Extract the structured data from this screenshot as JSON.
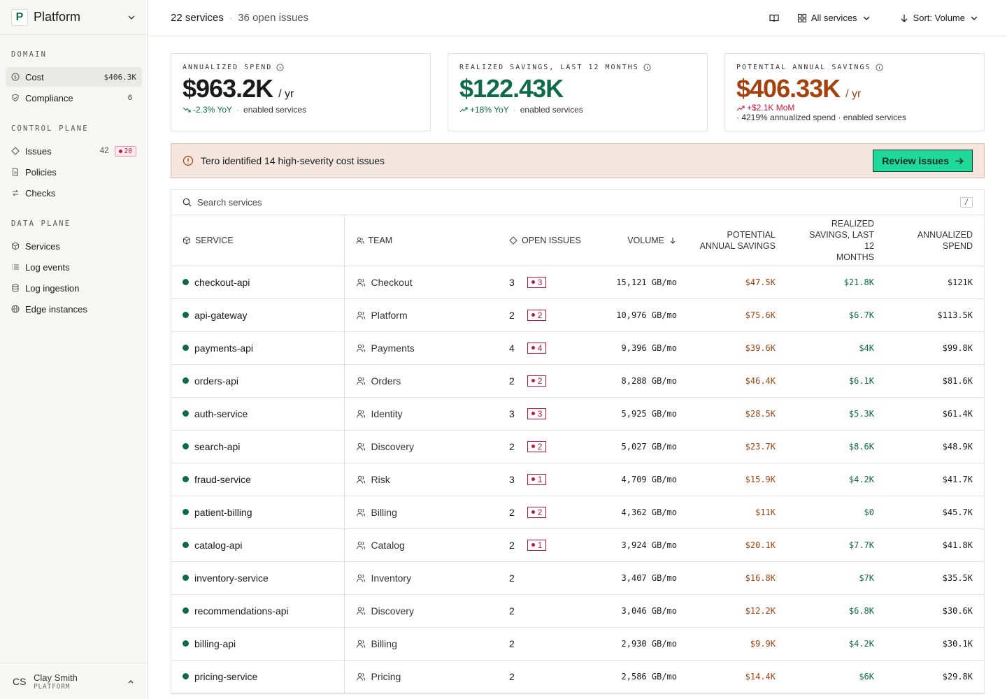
{
  "sidebar": {
    "workspace": {
      "letter": "P",
      "name": "Platform"
    },
    "sections": {
      "domain": "DOMAIN",
      "control": "CONTROL PLANE",
      "data": "DATA PLANE"
    },
    "items": {
      "cost": {
        "label": "Cost",
        "badge": "$406.3K"
      },
      "compliance": {
        "label": "Compliance",
        "badge": "6"
      },
      "issues": {
        "label": "Issues",
        "count": "42",
        "flag": "20"
      },
      "policies": {
        "label": "Policies"
      },
      "checks": {
        "label": "Checks"
      },
      "services": {
        "label": "Services"
      },
      "log_events": {
        "label": "Log events"
      },
      "log_ingestion": {
        "label": "Log ingestion"
      },
      "edge_instances": {
        "label": "Edge instances"
      }
    },
    "user": {
      "initials": "CS",
      "name": "Clay Smith",
      "org": "PLATFORM"
    }
  },
  "topbar": {
    "title": "22 services",
    "sep": "·",
    "subtitle": "36 open issues",
    "filter_label": "All services",
    "sort_label": "Sort: Volume"
  },
  "cards": {
    "spend": {
      "label": "ANNUALIZED SPEND",
      "value": "$963.2K",
      "unit": "/ yr",
      "trend": "-2.3% YoY",
      "sep": "·",
      "note": "enabled services"
    },
    "realized": {
      "label": "REALIZED SAVINGS, LAST 12 MONTHS",
      "value": "$122.43K",
      "trend": "+18% YoY",
      "sep": "·",
      "note": "enabled services"
    },
    "potential": {
      "label": "POTENTIAL ANNUAL SAVINGS",
      "value": "$406.33K",
      "unit": "/ yr",
      "trend": "+$2.1K MoM",
      "note": "· 4219% annualized spend · enabled services"
    }
  },
  "alert": {
    "text": "Tero identified 14 high-severity cost issues",
    "button": "Review issues"
  },
  "search": {
    "placeholder": "Search services",
    "shortcut": "/"
  },
  "table": {
    "headers": {
      "service": "SERVICE",
      "team": "TEAM",
      "issues": "OPEN ISSUES",
      "volume": "VOLUME",
      "potential_1": "POTENTIAL",
      "potential_2": "ANNUAL SAVINGS",
      "realized_1": "REALIZED",
      "realized_2": "SAVINGS, LAST 12",
      "realized_3": "MONTHS",
      "spend_1": "ANNUALIZED",
      "spend_2": "SPEND"
    },
    "rows": [
      {
        "service": "checkout-api",
        "team": "Checkout",
        "issues": "3",
        "sev": "3",
        "volume": "15,121 GB/mo",
        "potential": "$47.5K",
        "realized": "$21.8K",
        "spend": "$121K"
      },
      {
        "service": "api-gateway",
        "team": "Platform",
        "issues": "2",
        "sev": "2",
        "volume": "10,976 GB/mo",
        "potential": "$75.6K",
        "realized": "$6.7K",
        "spend": "$113.5K"
      },
      {
        "service": "payments-api",
        "team": "Payments",
        "issues": "4",
        "sev": "4",
        "volume": "9,396 GB/mo",
        "potential": "$39.6K",
        "realized": "$4K",
        "spend": "$99.8K"
      },
      {
        "service": "orders-api",
        "team": "Orders",
        "issues": "2",
        "sev": "2",
        "volume": "8,288 GB/mo",
        "potential": "$46.4K",
        "realized": "$6.1K",
        "spend": "$81.6K"
      },
      {
        "service": "auth-service",
        "team": "Identity",
        "issues": "3",
        "sev": "3",
        "volume": "5,925 GB/mo",
        "potential": "$28.5K",
        "realized": "$5.3K",
        "spend": "$61.4K"
      },
      {
        "service": "search-api",
        "team": "Discovery",
        "issues": "2",
        "sev": "2",
        "volume": "5,027 GB/mo",
        "potential": "$23.7K",
        "realized": "$8.6K",
        "spend": "$48.9K"
      },
      {
        "service": "fraud-service",
        "team": "Risk",
        "issues": "3",
        "sev": "1",
        "volume": "4,709 GB/mo",
        "potential": "$15.9K",
        "realized": "$4.2K",
        "spend": "$41.7K"
      },
      {
        "service": "patient-billing",
        "team": "Billing",
        "issues": "2",
        "sev": "2",
        "volume": "4,362 GB/mo",
        "potential": "$11K",
        "realized": "$0",
        "spend": "$45.7K"
      },
      {
        "service": "catalog-api",
        "team": "Catalog",
        "issues": "2",
        "sev": "1",
        "volume": "3,924 GB/mo",
        "potential": "$20.1K",
        "realized": "$7.7K",
        "spend": "$41.8K"
      },
      {
        "service": "inventory-service",
        "team": "Inventory",
        "issues": "2",
        "sev": null,
        "volume": "3,407 GB/mo",
        "potential": "$16.8K",
        "realized": "$7K",
        "spend": "$35.5K"
      },
      {
        "service": "recommendations-api",
        "team": "Discovery",
        "issues": "2",
        "sev": null,
        "volume": "3,046 GB/mo",
        "potential": "$12.2K",
        "realized": "$6.8K",
        "spend": "$30.6K"
      },
      {
        "service": "billing-api",
        "team": "Billing",
        "issues": "2",
        "sev": null,
        "volume": "2,930 GB/mo",
        "potential": "$9.9K",
        "realized": "$4.2K",
        "spend": "$30.1K"
      },
      {
        "service": "pricing-service",
        "team": "Pricing",
        "issues": "2",
        "sev": null,
        "volume": "2,586 GB/mo",
        "potential": "$14.4K",
        "realized": "$6K",
        "spend": "$29.8K"
      }
    ]
  },
  "colors": {
    "accent_green": "#0e6b49",
    "accent_orange": "#a5410d",
    "alert_red": "#c8143c",
    "cta": "#1fd99a"
  }
}
